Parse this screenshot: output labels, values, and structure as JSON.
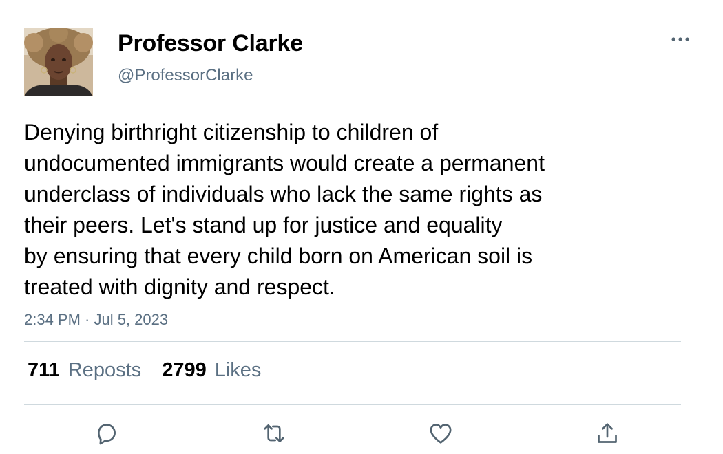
{
  "user": {
    "display_name": "Professor Clarke",
    "handle": "@ProfessorClarke",
    "avatar_icon": "avatar-photo"
  },
  "tweet": {
    "text_lines": [
      "Denying birthright citizenship to children of",
      "undocumented immigrants would create a permanent",
      "underclass of individuals who lack the same rights as",
      "their peers. Let's stand up for justice and equality",
      "by ensuring that every child born on American soil is",
      "treated with dignity and respect."
    ],
    "timestamp": "2:34 PM · Jul 5, 2023"
  },
  "stats": {
    "reposts_count": "711",
    "reposts_label": "Reposts",
    "likes_count": "2799",
    "likes_label": "Likes"
  },
  "actions": [
    {
      "name": "reply",
      "icon": "reply-icon"
    },
    {
      "name": "repost",
      "icon": "repost-icon"
    },
    {
      "name": "like",
      "icon": "heart-icon"
    },
    {
      "name": "share",
      "icon": "share-icon"
    }
  ],
  "menu": {
    "icon": "more-options-icon"
  },
  "colors": {
    "text_primary": "#000000",
    "text_secondary": "#5b7083",
    "divider": "#cfd9de",
    "icon": "#536471"
  }
}
